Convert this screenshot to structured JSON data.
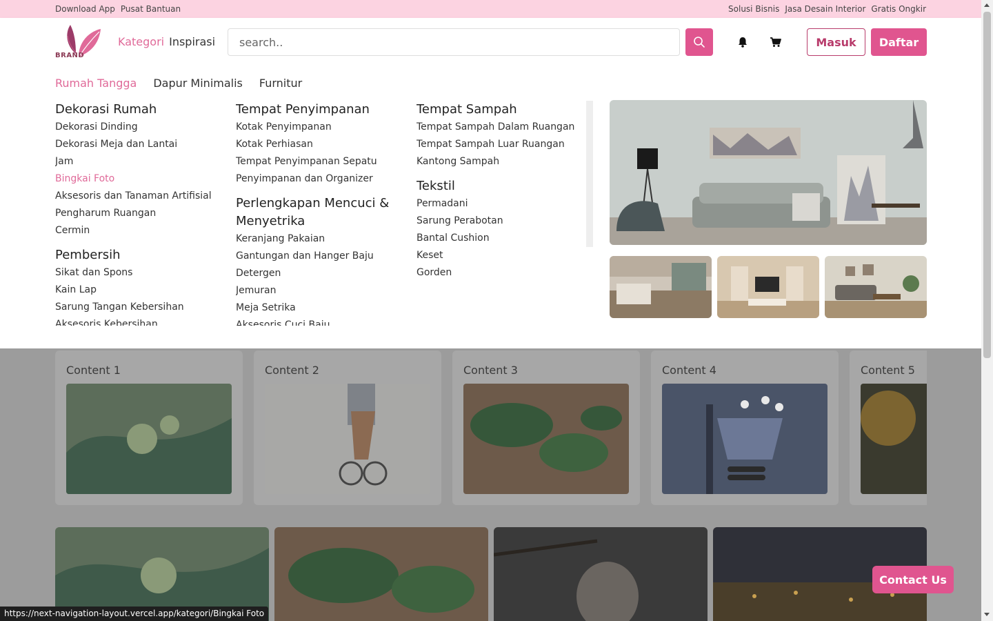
{
  "topbar": {
    "left": [
      "Download App",
      "Pusat Bantuan"
    ],
    "right": [
      "Solusi Bisnis",
      "Jasa Desain Interior",
      "Gratis Ongkir"
    ]
  },
  "header": {
    "logo_text": "BRAND",
    "nav_kategori": "Kategori",
    "nav_inspirasi": "Inspirasi",
    "search_placeholder": "search..",
    "masuk": "Masuk",
    "daftar": "Daftar",
    "icons": {
      "search": "search-icon",
      "bell": "bell-icon",
      "cart": "cart-icon"
    }
  },
  "mega": {
    "tabs": [
      "Rumah Tangga",
      "Dapur Minimalis",
      "Furnitur"
    ],
    "active_tab": "Rumah Tangga",
    "col1": [
      {
        "title": "Dekorasi Rumah",
        "items": [
          "Dekorasi Dinding",
          "Dekorasi Meja dan Lantai",
          "Jam",
          "Bingkai Foto",
          "Aksesoris dan Tanaman Artifisial",
          "Pengharum Ruangan",
          "Cermin"
        ]
      },
      {
        "title": "Pembersih",
        "items": [
          "Sikat dan Spons",
          "Kain Lap",
          "Sarung Tangan Kebersihan",
          "Aksesoris Kebersihan"
        ]
      }
    ],
    "col2": [
      {
        "title": "Tempat Penyimpanan",
        "items": [
          "Kotak Penyimpanan",
          "Kotak Perhiasan",
          "Tempat Penyimpanan Sepatu",
          "Penyimpanan dan Organizer"
        ]
      },
      {
        "title": "Perlengkapan Mencuci & Menyetrika",
        "items": [
          "Keranjang Pakaian",
          "Gantungan dan Hanger Baju",
          "Detergen",
          "Jemuran",
          "Meja Setrika",
          "Aksesoris Cuci Baju"
        ]
      }
    ],
    "col3": [
      {
        "title": "Tempat Sampah",
        "items": [
          "Tempat Sampah Dalam Ruangan",
          "Tempat Sampah Luar Ruangan",
          "Kantong Sampah"
        ]
      },
      {
        "title": "Tekstil",
        "items": [
          "Permadani",
          "Sarung Perabotan",
          "Bantal Cushion",
          "Keset",
          "Gorden"
        ]
      }
    ],
    "highlight_item": "Bingkai Foto"
  },
  "cards": [
    "Content 1",
    "Content 2",
    "Content 3",
    "Content 4",
    "Content 5"
  ],
  "contact": "Contact Us",
  "status_url": "https://next-navigation-layout.vercel.app/kategori/Bingkai Foto",
  "colors": {
    "accent": "#e0558f",
    "accent_text": "#e06a99",
    "topbar": "#fcd3e1",
    "overlay": "#9c9c9c"
  }
}
